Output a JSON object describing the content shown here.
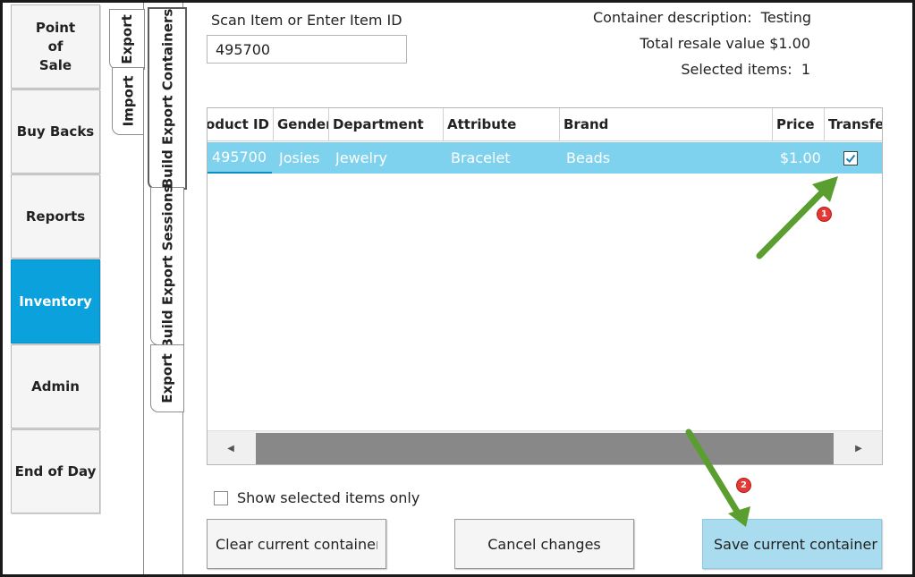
{
  "nav": {
    "items": [
      {
        "label": "Point\nof\nSale",
        "active": false
      },
      {
        "label": "Buy Backs",
        "active": false
      },
      {
        "label": "Reports",
        "active": false
      },
      {
        "label": "Inventory",
        "active": true
      },
      {
        "label": "Admin",
        "active": false
      },
      {
        "label": "End of Day",
        "active": false
      }
    ]
  },
  "tabs": {
    "outer": [
      {
        "label": "Export",
        "selected": true
      },
      {
        "label": "Import",
        "selected": false
      }
    ],
    "inner": [
      {
        "label": "Build Export Containers",
        "selected": true
      },
      {
        "label": "Build Export Sessions",
        "selected": false
      },
      {
        "label": "Export",
        "selected": false
      }
    ]
  },
  "scan": {
    "label": "Scan Item or Enter Item ID",
    "value": "495700"
  },
  "container": {
    "description_label": "Container description:",
    "description_value": "Testing",
    "resale_label": "Total resale value",
    "resale_value": "$1.00",
    "selected_label": "Selected items:",
    "selected_value": "1"
  },
  "grid": {
    "columns": [
      "Product ID",
      "Gender",
      "Department",
      "Attribute",
      "Brand",
      "Price",
      "Transfer"
    ],
    "rows": [
      {
        "product_id": "495700",
        "gender": "Josies",
        "department": "Jewelry",
        "attribute": "Bracelet",
        "brand": "Beads",
        "price": "$1.00",
        "transfer": true
      }
    ],
    "scroll_left": "◀",
    "scroll_right": "▶"
  },
  "options": {
    "show_selected_label": "Show selected items only",
    "show_selected_checked": false
  },
  "buttons": {
    "clear": "Clear current container",
    "cancel": "Cancel changes",
    "save": "Save current container"
  },
  "annotations": {
    "badge_1": "1",
    "badge_2": "2",
    "arrow_color": "#5a9e2f",
    "badge_color": "#e53935"
  },
  "colors": {
    "accent": "#0aa1dc",
    "row_selected": "#7fd2ee",
    "primary_button": "#a9dcef"
  }
}
